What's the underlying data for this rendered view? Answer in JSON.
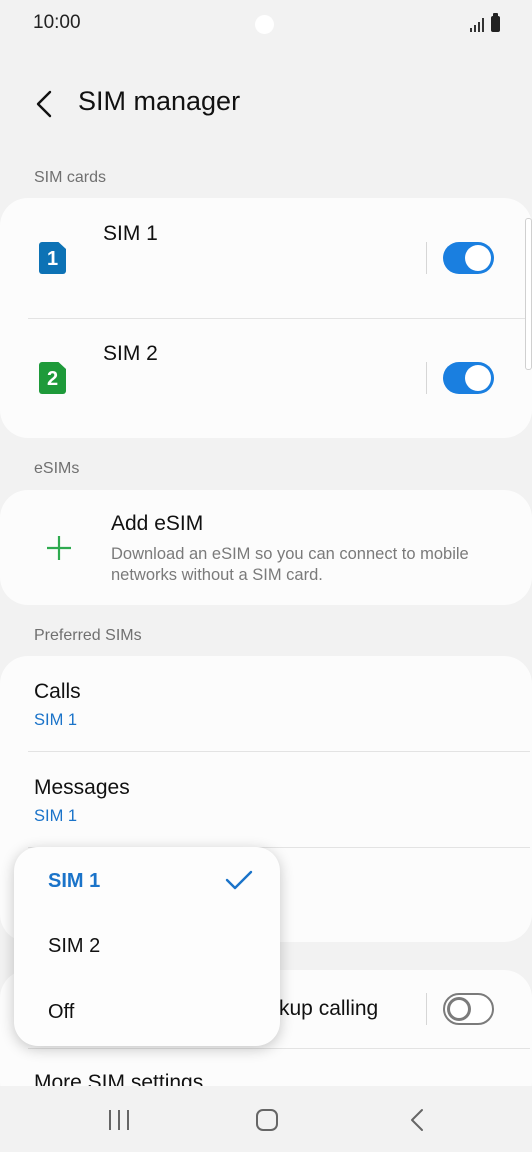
{
  "status_bar": {
    "time": "10:00"
  },
  "header": {
    "title": "SIM manager"
  },
  "sections": {
    "sim_cards": "SIM cards",
    "esims": "eSIMs",
    "preferred": "Preferred SIMs"
  },
  "sim_cards": [
    {
      "name": "SIM 1",
      "badge": "1",
      "color": "#0d72b5",
      "enabled": true
    },
    {
      "name": "SIM 2",
      "badge": "2",
      "color": "#1e9a3a",
      "enabled": true
    }
  ],
  "esim": {
    "title": "Add eSIM",
    "description": "Download an eSIM so you can connect to mobile networks without a SIM card."
  },
  "preferred": {
    "calls": {
      "label": "Calls",
      "value": "SIM 1"
    },
    "messages": {
      "label": "Messages",
      "value": "SIM 1"
    }
  },
  "backup_calling": {
    "label_partial": "kup calling",
    "enabled": false
  },
  "more_settings": "More SIM settings",
  "popup": {
    "options": [
      "SIM 1",
      "SIM 2",
      "Off"
    ],
    "selected": "SIM 1"
  },
  "colors": {
    "accent": "#1a7fe0",
    "link": "#1a73c9",
    "esim_plus": "#2eaa4f"
  }
}
